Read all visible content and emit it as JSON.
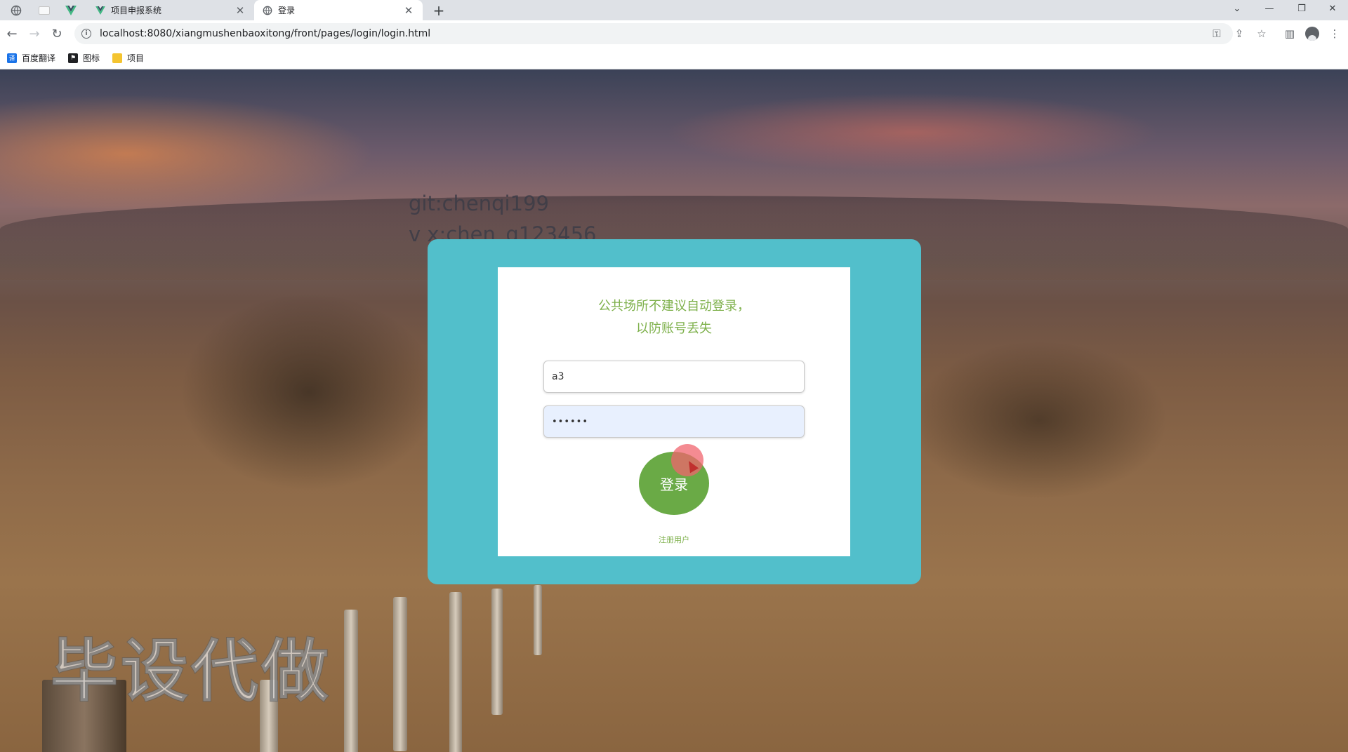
{
  "browser": {
    "tabs": [
      {
        "title": "项目申报系统",
        "active": false
      },
      {
        "title": "登录",
        "active": true
      }
    ],
    "new_tab_symbol": "+",
    "url": "localhost:8080/xiangmushenbaoxitong/front/pages/login/login.html",
    "bookmarks": [
      {
        "label": "百度翻译",
        "icon": "translate-icon",
        "color": "#1a73e8"
      },
      {
        "label": "图标",
        "icon": "flag-icon",
        "color": "#202124"
      },
      {
        "label": "项目",
        "icon": "folder-icon",
        "color": "#f4c430"
      }
    ]
  },
  "watermark": {
    "line1": "git:chenqi199",
    "line2": "v x:chen_q123456",
    "bottom": "毕设代做"
  },
  "login": {
    "tip": "公共场所不建议自动登录，以防账号丢失",
    "username_value": "a3",
    "password_value": "••••••",
    "submit_label": "登录",
    "register_label": "注册用户"
  },
  "colors": {
    "card_outer": "#52bfcb",
    "accent_green": "#7db04a",
    "button_green": "#6aaa46"
  }
}
